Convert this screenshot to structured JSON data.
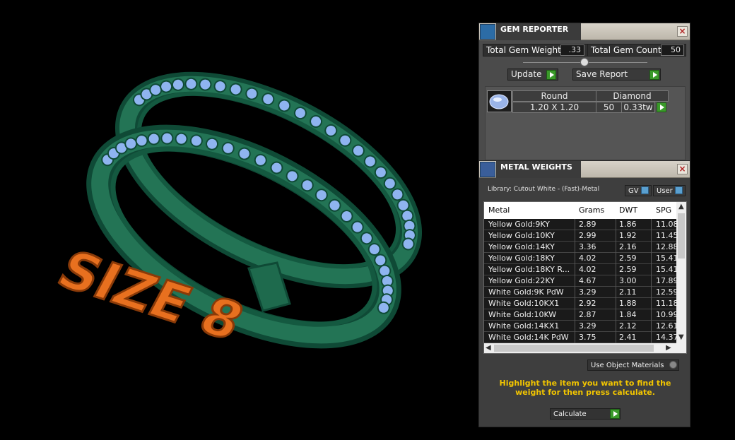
{
  "gem_reporter": {
    "title": "GEM REPORTER",
    "total_weight_label": "Total Gem Weight",
    "total_weight_value": ".33",
    "total_count_label": "Total Gem Count",
    "total_count_value": "50",
    "update_label": "Update",
    "save_report_label": "Save Report",
    "gems": [
      {
        "shape": "Round",
        "material": "Diamond",
        "size": "1.20 X 1.20",
        "count": "50",
        "weight": "0.33tw"
      }
    ]
  },
  "metal_weights": {
    "title": "METAL WEIGHTS",
    "library": "Library: Cutout White - (Fast)-Metal",
    "gv_label": "GV",
    "user_label": "User",
    "columns": [
      "Metal",
      "Grams",
      "DWT",
      "SPG"
    ],
    "rows": [
      [
        "Yellow Gold:9KY",
        "2.89",
        "1.86",
        "11.08"
      ],
      [
        "Yellow Gold:10KY",
        "2.99",
        "1.92",
        "11.45"
      ],
      [
        "Yellow Gold:14KY",
        "3.36",
        "2.16",
        "12.88"
      ],
      [
        "Yellow Gold:18KY",
        "4.02",
        "2.59",
        "15.41"
      ],
      [
        "Yellow Gold:18KY R...",
        "4.02",
        "2.59",
        "15.41"
      ],
      [
        "Yellow Gold:22KY",
        "4.67",
        "3.00",
        "17.89"
      ],
      [
        "White Gold:9K PdW",
        "3.29",
        "2.11",
        "12.59"
      ],
      [
        "White Gold:10KX1",
        "2.92",
        "1.88",
        "11.18"
      ],
      [
        "White Gold:10KW",
        "2.87",
        "1.84",
        "10.99"
      ],
      [
        "White Gold:14KX1",
        "3.29",
        "2.12",
        "12.61"
      ],
      [
        "White Gold:14K PdW",
        "3.75",
        "2.41",
        "14.37"
      ]
    ],
    "use_object_materials_label": "Use Object Materials",
    "instruction": "Highlight the item you want to find the weight for then press calculate.",
    "calculate_label": "Calculate"
  },
  "viewport": {
    "size_text": "SIZE 8"
  },
  "colors": {
    "ring": "#1f6b4f",
    "gems": "#8fb4f0",
    "size_text": "#e8701f",
    "instruction": "#f2c500"
  }
}
